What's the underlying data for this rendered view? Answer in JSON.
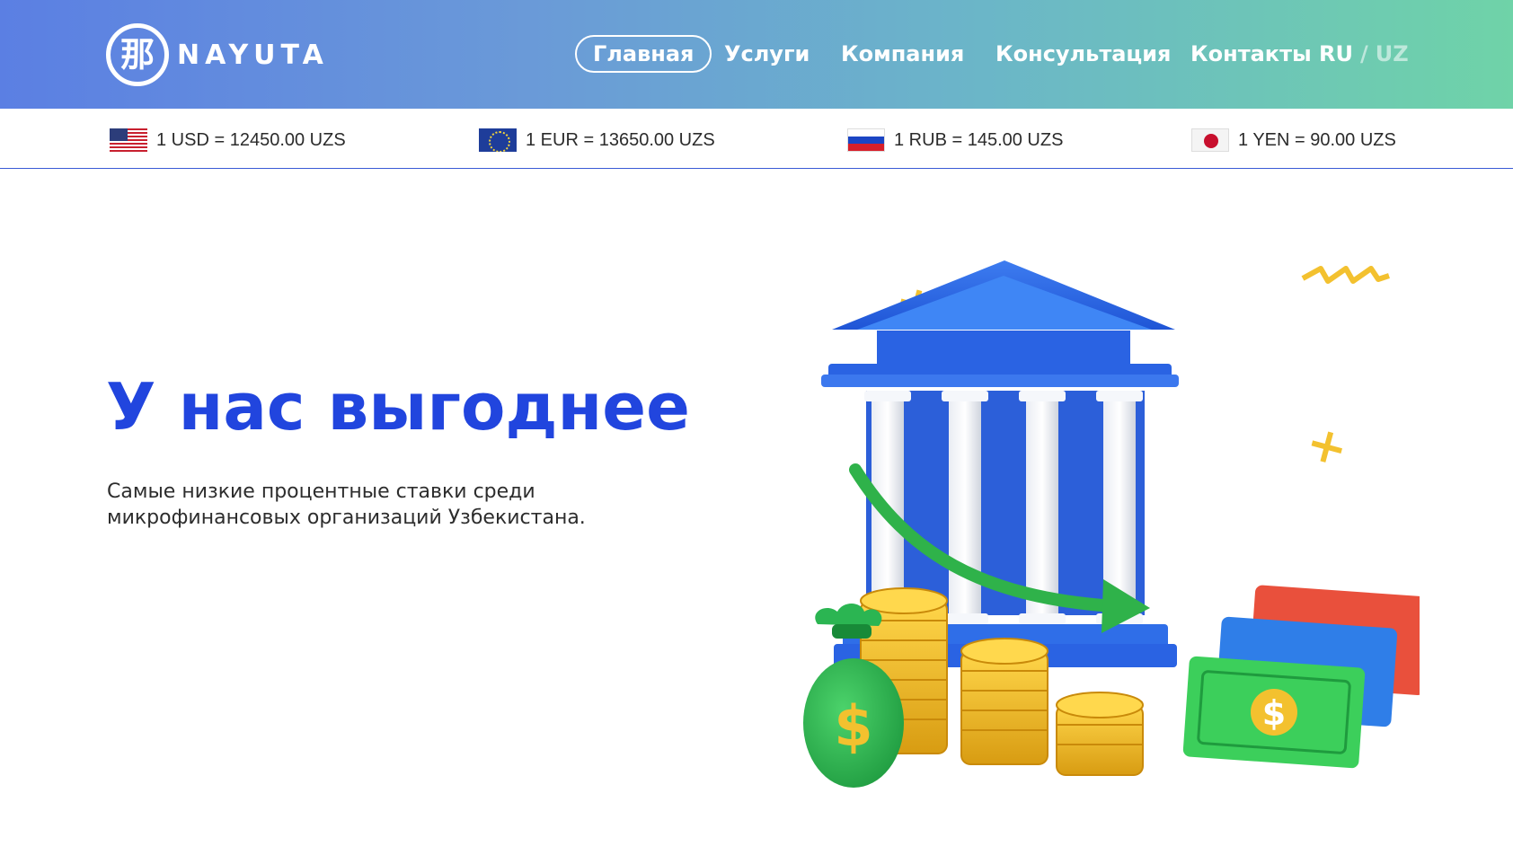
{
  "header": {
    "logo": {
      "mark": "那",
      "name": "NAYUTA"
    },
    "nav": [
      {
        "label": "Главная",
        "active": true
      },
      {
        "label": "Услуги",
        "active": false
      },
      {
        "label": "Компания",
        "active": false
      },
      {
        "label": "Консультация",
        "active": false
      },
      {
        "label": "Контакты",
        "active": false
      }
    ],
    "lang": {
      "ru": "RU",
      "separator": "/",
      "uz": "UZ",
      "selected": "RU"
    }
  },
  "rates": [
    {
      "flag": "us-flag-icon",
      "text": "1 USD = 12450.00 UZS"
    },
    {
      "flag": "eu-flag-icon",
      "text": "1 EUR = 13650.00 UZS"
    },
    {
      "flag": "ru-flag-icon",
      "text": "1 RUB = 145.00 UZS"
    },
    {
      "flag": "jp-flag-icon",
      "text": "1 YEN = 90.00 UZS"
    }
  ],
  "hero": {
    "title": "У нас выгоднее",
    "subtitle": "Самые низкие процентные ставки среди микрофинансовых организаций Узбекистана.",
    "illustration": {
      "bank_mark": "$",
      "bag_mark": "$",
      "bill_mark": "$"
    }
  },
  "colors": {
    "gradient_start": "#5b7fe3",
    "gradient_end": "#6fd3a8",
    "accent_blue": "#2145de",
    "bank_blue": "#2f6ee8",
    "arrow_green": "#2fb24a",
    "coin_gold": "#f3c12f"
  }
}
